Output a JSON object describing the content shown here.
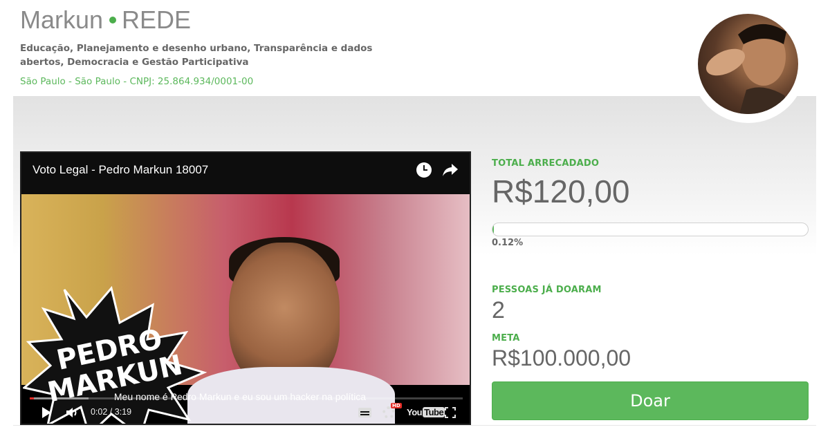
{
  "header": {
    "name": "Markun",
    "party": "REDE",
    "causes": "Educação, Planejamento e desenho urbano, Transparência e dados abertos, Democracia e Gestão Participativa",
    "location": "São Paulo - São Paulo - CNPJ: 25.864.934/0001-00"
  },
  "video": {
    "title": "Voto Legal - Pedro Markun 18007",
    "overlay_text_line1": "PEDRO",
    "overlay_text_line2": "MARKUN",
    "subtitle": "Meu nome é Pedro Markun e eu sou um hacker na política",
    "time": "0:02 / 3:19",
    "progress_fraction": 0.01,
    "buffer_fraction": 0.135,
    "youtube_logo_a": "You",
    "youtube_logo_b": "Tube",
    "hd_badge": "HD"
  },
  "stats": {
    "raised_label": "TOTAL ARRECADADO",
    "raised_value": "R$120,00",
    "progress_percent_text": "0.12%",
    "progress_fraction": 0.0012,
    "donors_label": "PESSOAS JÁ DOARAM",
    "donors_value": "2",
    "goal_label": "META",
    "goal_value": "R$100.000,00"
  },
  "actions": {
    "donate_label": "Doar"
  },
  "colors": {
    "accent_green": "#5cb85c",
    "label_green": "#4cae4c",
    "youtube_red": "#e52d27"
  },
  "icons": [
    "clock-icon",
    "share-icon",
    "play-icon",
    "volume-icon",
    "captions-icon",
    "gear-icon",
    "youtube-logo",
    "fullscreen-icon"
  ]
}
